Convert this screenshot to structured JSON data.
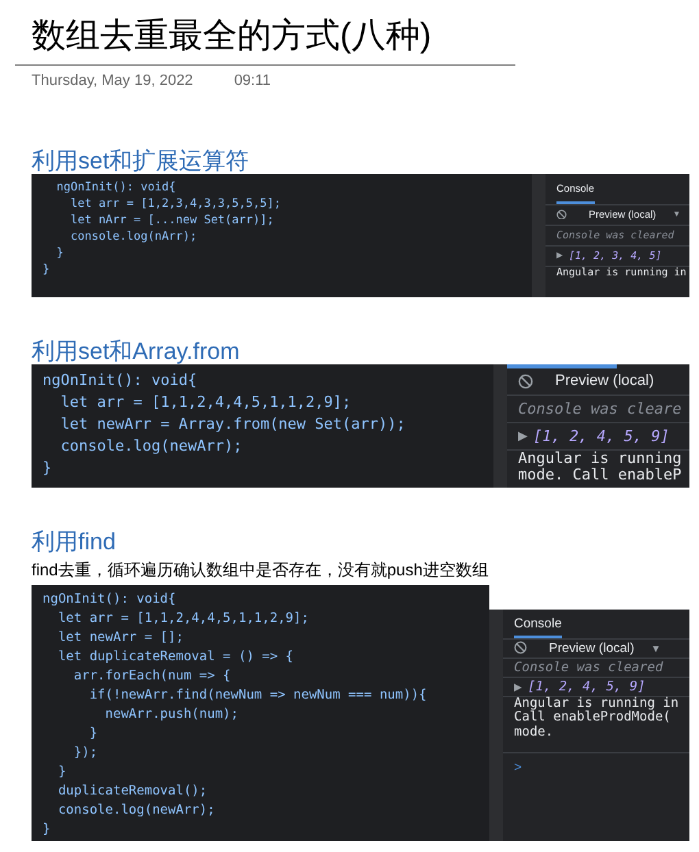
{
  "title": "数组去重最全的方式(八种)",
  "date": "Thursday, May 19, 2022",
  "time": "09:11",
  "sections": [
    {
      "heading": "利用set和扩展运算符",
      "code_lines": [
        "  ngOnInit(): void{",
        "    let arr = [1,2,3,4,3,3,5,5,5];",
        "    let nArr = [...new Set(arr)];",
        "    console.log(nArr);",
        "  }",
        "}"
      ],
      "console": {
        "tab": "Console",
        "filter": "Preview (local)",
        "dropdown": "▼",
        "lines": [
          {
            "kind": "cleared",
            "text": "Console was cleared"
          },
          {
            "kind": "result",
            "marker": "▶",
            "text": "[1, 2, 3, 4, 5]"
          },
          {
            "kind": "message",
            "text": "Angular is running in"
          }
        ]
      }
    },
    {
      "heading": "利用set和Array.from",
      "code_lines": [
        "ngOnInit(): void{",
        "  let arr = [1,1,2,4,4,5,1,1,2,9];",
        "  let newArr = Array.from(new Set(arr));",
        "  console.log(newArr);",
        "}"
      ],
      "console": {
        "filter": "Preview (local)",
        "lines": [
          {
            "kind": "cleared",
            "text": "Console was cleare"
          },
          {
            "kind": "result",
            "marker": "▶",
            "text": "[1, 2, 4, 5, 9]"
          },
          {
            "kind": "message",
            "text": "Angular is running"
          },
          {
            "kind": "message",
            "text": "mode. Call enableP"
          }
        ]
      }
    },
    {
      "heading": "利用find",
      "description": "find去重，循环遍历确认数组中是否存在，没有就push进空数组",
      "code_lines": [
        "ngOnInit(): void{",
        "  let arr = [1,1,2,4,4,5,1,1,2,9];",
        "  let newArr = [];",
        "  let duplicateRemoval = () => {",
        "    arr.forEach(num => {",
        "      if(!newArr.find(newNum => newNum === num)){",
        "        newArr.push(num);",
        "      }",
        "    });",
        "  }",
        "  duplicateRemoval();",
        "  console.log(newArr);",
        "}"
      ],
      "console": {
        "tab": "Console",
        "filter": "Preview (local)",
        "dropdown": "▼",
        "lines": [
          {
            "kind": "cleared",
            "text": "Console was cleared"
          },
          {
            "kind": "result",
            "marker": "▶",
            "text": "[1, 2, 4, 5, 9]"
          },
          {
            "kind": "message",
            "text": "Angular is running in"
          },
          {
            "kind": "message",
            "text": "Call enableProdMode("
          },
          {
            "kind": "message",
            "text": "mode."
          },
          {
            "kind": "prompt",
            "text": ">"
          }
        ]
      }
    }
  ]
}
